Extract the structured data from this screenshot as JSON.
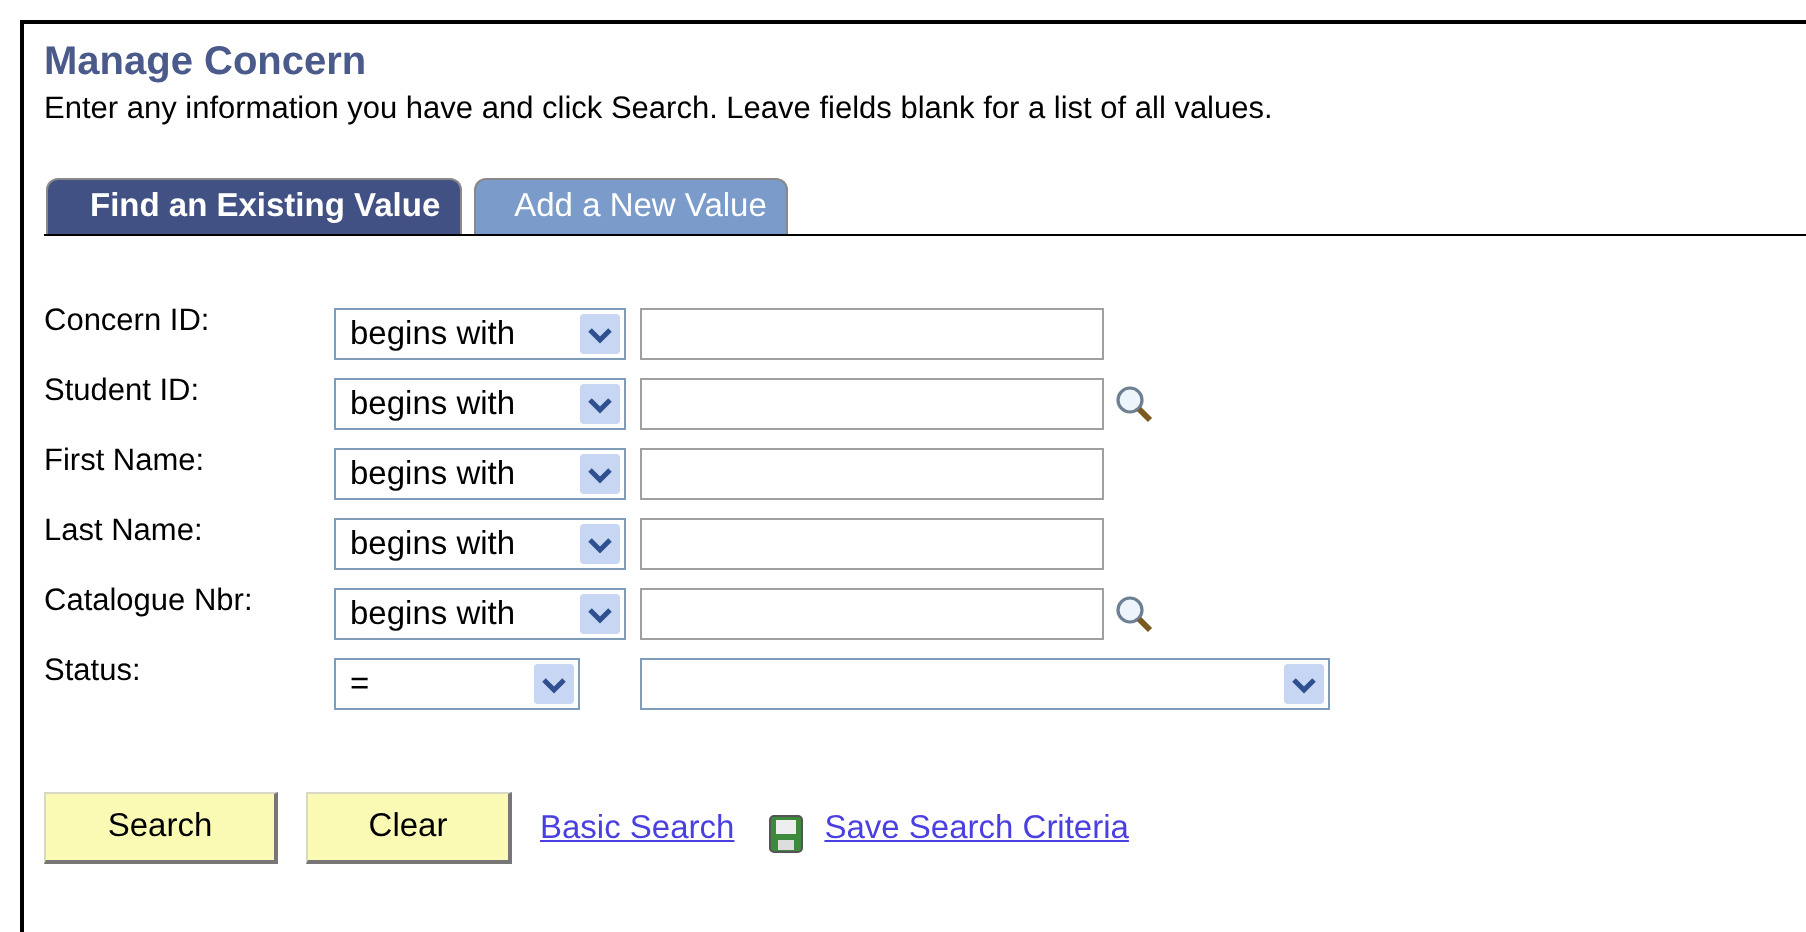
{
  "page": {
    "title": "Manage Concern",
    "instructions": "Enter any information you have and click Search. Leave fields blank for a list of all values."
  },
  "tabs": [
    {
      "label": "Find an Existing Value",
      "selected": true
    },
    {
      "label": "Add a New Value",
      "selected": false
    }
  ],
  "fields": [
    {
      "label": "Concern ID:",
      "operator": "begins with",
      "kind": "text",
      "lookup": false
    },
    {
      "label": "Student ID:",
      "operator": "begins with",
      "kind": "text",
      "lookup": true
    },
    {
      "label": "First Name:",
      "operator": "begins with",
      "kind": "text",
      "lookup": false
    },
    {
      "label": "Last Name:",
      "operator": "begins with",
      "kind": "text",
      "lookup": false
    },
    {
      "label": "Catalogue Nbr:",
      "operator": "begins with",
      "kind": "text",
      "lookup": true
    },
    {
      "label": "Status:",
      "operator": "=",
      "kind": "dropdown",
      "lookup": false
    }
  ],
  "buttons": [
    "Search",
    "Clear"
  ],
  "links": [
    {
      "label": "Basic Search",
      "icon": false
    },
    {
      "label": "Save Search Criteria",
      "icon": true
    }
  ]
}
